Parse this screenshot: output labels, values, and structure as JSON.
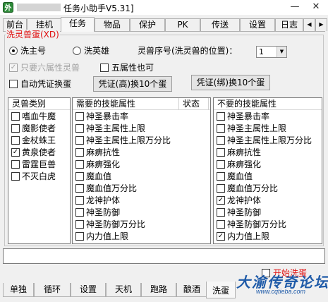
{
  "window": {
    "title": "任务小助手V5.31]",
    "minimize": "—",
    "close": "✕"
  },
  "tabs": [
    "前台",
    "挂机",
    "任务",
    "物品",
    "保护",
    "PK",
    "传送",
    "设置",
    "日志"
  ],
  "active_tab": "任务",
  "group": {
    "legend": "洗灵兽蛋(XD)",
    "radio_main": "洗主号",
    "radio_hero": "洗英雄",
    "seq_label": "灵兽序号(洗灵兽的位置)：",
    "seq_value": "1",
    "only_six": "只要六属性灵兽",
    "five_ok": "五属性也可",
    "auto_exchange": "自动凭证换蛋",
    "btn_high": "凭证(高)换10个蛋",
    "btn_bind": "凭证(绑)换10个蛋"
  },
  "left_panel": {
    "header": "灵兽类别",
    "items": [
      {
        "label": "嗜血牛魔",
        "checked": false
      },
      {
        "label": "魔影使者",
        "checked": false
      },
      {
        "label": "金杖蛛王",
        "checked": false
      },
      {
        "label": "黄泉使者",
        "checked": true
      },
      {
        "label": "雷霆巨兽",
        "checked": false
      },
      {
        "label": "不灭白虎",
        "checked": false
      }
    ]
  },
  "mid_panel": {
    "header": "需要的技能属性",
    "header2": "状态",
    "items": [
      {
        "label": "神圣暴击率",
        "checked": false
      },
      {
        "label": "神圣主属性上限",
        "checked": false
      },
      {
        "label": "神圣主属性上限万分比",
        "checked": false
      },
      {
        "label": "麻痹抗性",
        "checked": false
      },
      {
        "label": "麻痹强化",
        "checked": false
      },
      {
        "label": "魔血值",
        "checked": false
      },
      {
        "label": "魔血值万分比",
        "checked": false
      },
      {
        "label": "龙神护体",
        "checked": false
      },
      {
        "label": "神圣防御",
        "checked": false
      },
      {
        "label": "神圣防御万分比",
        "checked": false
      },
      {
        "label": "内力值上限",
        "checked": false
      }
    ]
  },
  "right_panel": {
    "header": "不要的技能属性",
    "items": [
      {
        "label": "神圣暴击率",
        "checked": false
      },
      {
        "label": "神圣主属性上限",
        "checked": false
      },
      {
        "label": "神圣主属性上限万分比",
        "checked": false
      },
      {
        "label": "麻痹抗性",
        "checked": false
      },
      {
        "label": "麻痹强化",
        "checked": false
      },
      {
        "label": "魔血值",
        "checked": false
      },
      {
        "label": "魔血值万分比",
        "checked": false
      },
      {
        "label": "龙神护体",
        "checked": true
      },
      {
        "label": "神圣防御",
        "checked": false
      },
      {
        "label": "神圣防御万分比",
        "checked": false
      },
      {
        "label": "内力值上限",
        "checked": true
      }
    ]
  },
  "start_label": "开始洗蛋",
  "bottom_tabs": [
    "单独",
    "循环",
    "设置",
    "天机",
    "跑路",
    "酿酒",
    "洗蛋"
  ],
  "active_bottom_tab": "洗蛋",
  "watermark": {
    "text": "大渝传奇论坛",
    "url": "www.cqtieba.com"
  },
  "colors": {
    "accent_red": "#e01010",
    "watermark_blue": "#1e5aa8"
  }
}
